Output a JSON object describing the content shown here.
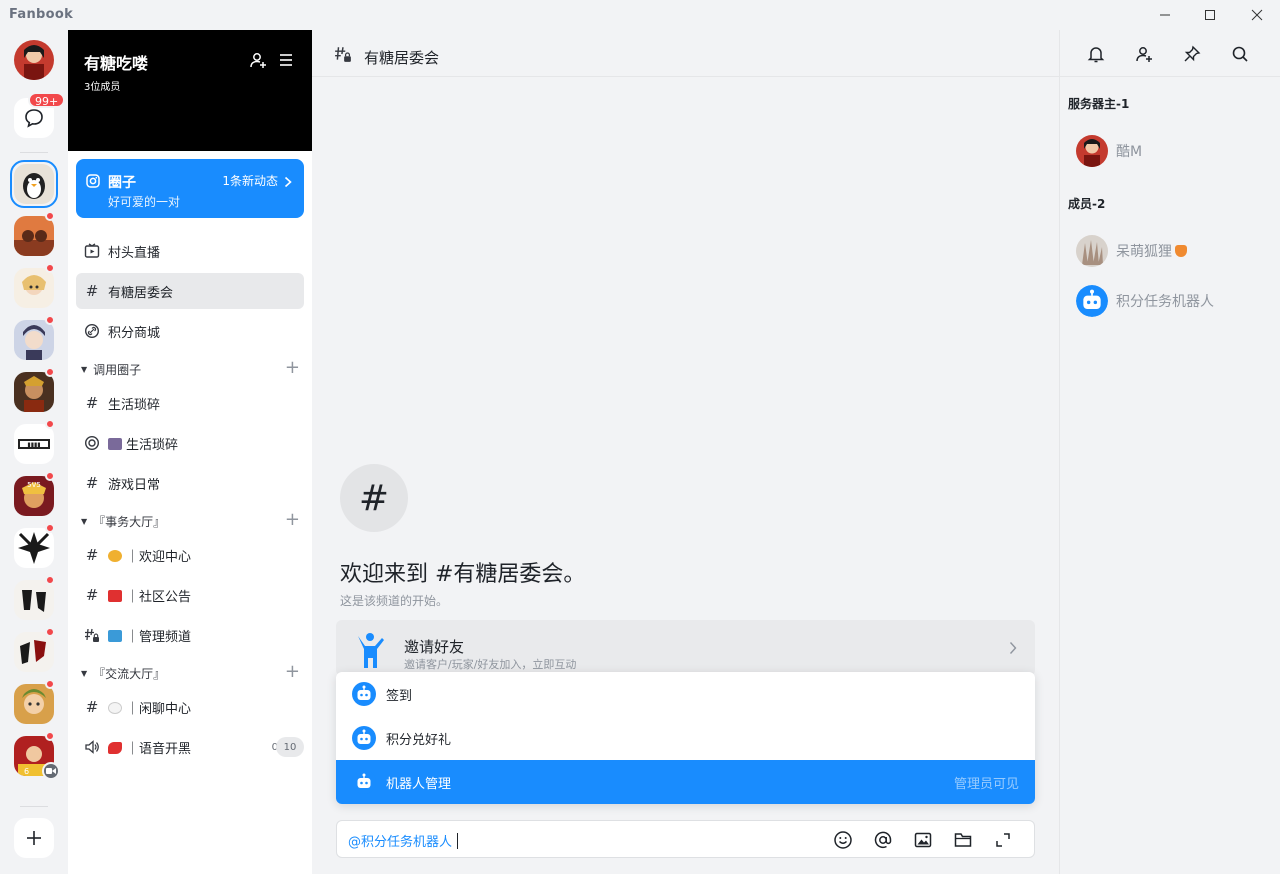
{
  "app": {
    "title": "Fanbook"
  },
  "rail": {
    "dm_badge": "99+"
  },
  "guild": {
    "name": "有糖吃喽",
    "member_count": "3位成员"
  },
  "circle": {
    "title": "圈子",
    "subtitle": "好可爱的一对",
    "new_posts": "1条新动态"
  },
  "channels": {
    "top": [
      {
        "label": "村头直播",
        "icon": "live-icon"
      },
      {
        "label": "有糖居委会",
        "icon": "hash-icon"
      },
      {
        "label": "积分商城",
        "icon": "link-icon"
      }
    ],
    "categories": [
      {
        "label": "调用圈子",
        "items": [
          {
            "label": "生活琐碎",
            "icon": "hash-icon"
          },
          {
            "label": "生活琐碎",
            "icon": "circle-icon"
          },
          {
            "label": "游戏日常",
            "icon": "hash-icon"
          }
        ]
      },
      {
        "label": "『事务大厅』",
        "items": [
          {
            "label": "｜欢迎中心",
            "icon": "hash-icon"
          },
          {
            "label": "｜社区公告",
            "icon": "hash-icon"
          },
          {
            "label": "｜管理频道",
            "icon": "private-hash-icon"
          }
        ]
      },
      {
        "label": "『交流大厅』",
        "items": [
          {
            "label": "｜闲聊中心",
            "icon": "hash-icon"
          },
          {
            "label": "｜语音开黑",
            "icon": "voice-icon",
            "online": "0",
            "capacity": "10"
          }
        ]
      }
    ]
  },
  "channel_header": {
    "title": "有糖居委会"
  },
  "welcome": {
    "title": "欢迎来到 #有糖居委会。",
    "subtitle": "这是该频道的开始。"
  },
  "invite": {
    "title": "邀请好友",
    "subtitle": "邀请客户/玩家/好友加入，立即互动"
  },
  "command_popup": {
    "items": [
      {
        "label": "签到"
      },
      {
        "label": "积分兑好礼"
      },
      {
        "label": "机器人管理",
        "note": "管理员可见"
      }
    ]
  },
  "composer": {
    "mention": "@积分任务机器人"
  },
  "members": {
    "owner_group": "服务器主-1",
    "owner": "酷M",
    "member_group": "成员-2",
    "list": [
      {
        "name": "呆萌狐狸"
      },
      {
        "name": "积分任务机器人"
      }
    ]
  },
  "colors": {
    "accent": "#198cfe",
    "badge": "#f2484b",
    "header_bg": "#000000"
  }
}
